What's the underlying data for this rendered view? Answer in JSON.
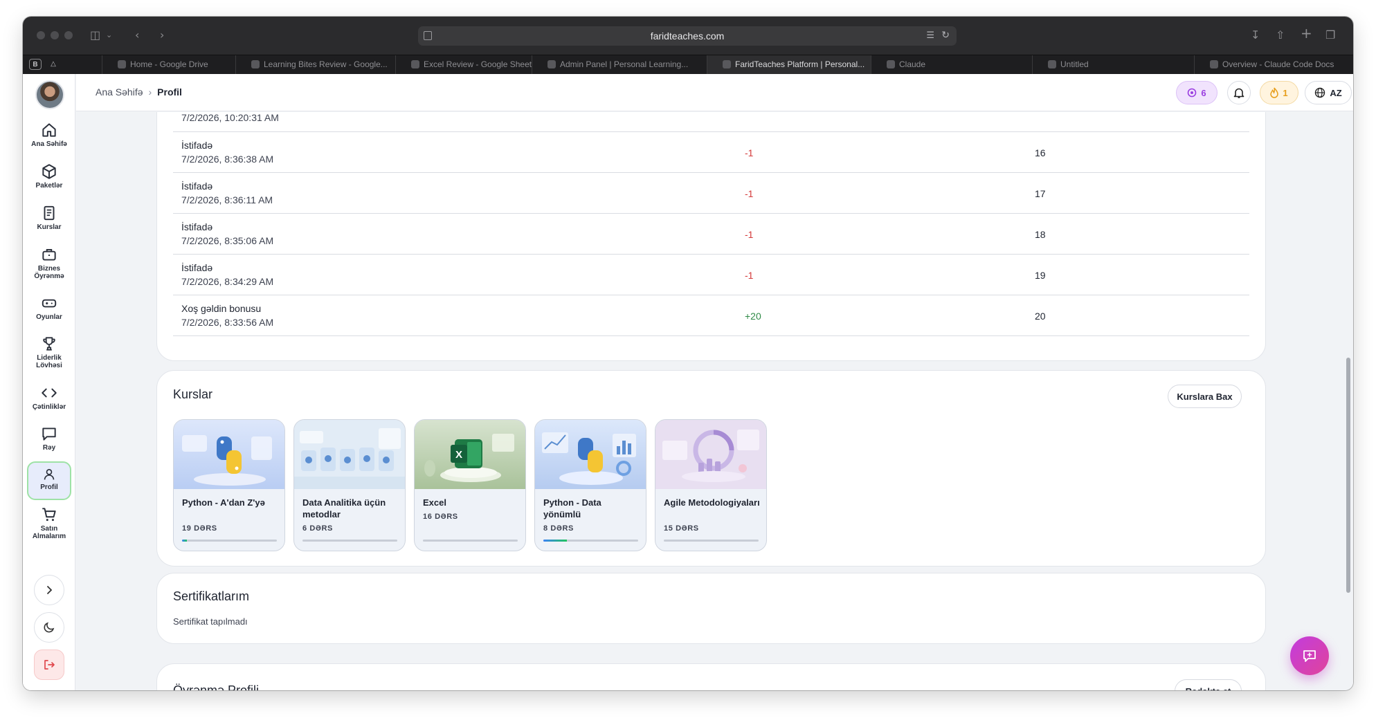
{
  "browser": {
    "url": "faridteaches.com",
    "pinned": [
      "B"
    ],
    "tabs": [
      {
        "label": "Home - Google Drive"
      },
      {
        "label": "Learning Bites Review - Google..."
      },
      {
        "label": "Excel Review - Google Sheets"
      },
      {
        "label": "Admin Panel | Personal Learning..."
      },
      {
        "label": "FaridTeaches Platform | Personal..."
      },
      {
        "label": "Claude"
      },
      {
        "label": "Untitled"
      },
      {
        "label": "Overview - Claude Code Docs"
      }
    ],
    "active_tab": 4
  },
  "sidebar": {
    "items": [
      {
        "label": "Ana Səhifə",
        "icon": "home-icon"
      },
      {
        "label": "Paketlər",
        "icon": "cube-icon"
      },
      {
        "label": "Kurslar",
        "icon": "document-icon"
      },
      {
        "label": "Biznes Öyrənmə",
        "icon": "briefcase-icon"
      },
      {
        "label": "Oyunlar",
        "icon": "gamepad-icon"
      },
      {
        "label": "Liderlik Lövhəsi",
        "icon": "trophy-icon"
      },
      {
        "label": "Çətinliklər",
        "icon": "code-icon"
      },
      {
        "label": "Rəy",
        "icon": "chat-bubble-icon"
      },
      {
        "label": "Profil",
        "icon": "user-icon"
      },
      {
        "label": "Satın Almalarım",
        "icon": "cart-icon"
      }
    ],
    "active": "Profil"
  },
  "header": {
    "breadcrumb": {
      "home": "Ana Səhifə",
      "current": "Profil"
    },
    "credits": "6",
    "streak": "1",
    "language": "AZ"
  },
  "transactions": {
    "partial_top_date": "7/2/2026, 10:20:31 AM",
    "rows": [
      {
        "type": "İstifadə",
        "date": "7/2/2026, 8:36:38 AM",
        "amount": "-1",
        "balance": "16"
      },
      {
        "type": "İstifadə",
        "date": "7/2/2026, 8:36:11 AM",
        "amount": "-1",
        "balance": "17"
      },
      {
        "type": "İstifadə",
        "date": "7/2/2026, 8:35:06 AM",
        "amount": "-1",
        "balance": "18"
      },
      {
        "type": "İstifadə",
        "date": "7/2/2026, 8:34:29 AM",
        "amount": "-1",
        "balance": "19"
      },
      {
        "type": "Xoş gəldin bonusu",
        "date": "7/2/2026, 8:33:56 AM",
        "amount": "+20",
        "balance": "20"
      }
    ]
  },
  "courses": {
    "title": "Kurslar",
    "view_button": "Kurslara Bax",
    "items": [
      {
        "name": "Python - A'dan Z'yə",
        "lessons": "19 DƏRS",
        "progress": 0.05,
        "theme": "python"
      },
      {
        "name": "Data Analitika üçün metodlar",
        "lessons": "6 DƏRS",
        "progress": 0,
        "theme": "analytics"
      },
      {
        "name": "Excel",
        "lessons": "16 DƏRS",
        "progress": 0,
        "theme": "excel"
      },
      {
        "name": "Python - Data yönümlü",
        "lessons": "8 DƏRS",
        "progress": 0.25,
        "theme": "python-data"
      },
      {
        "name": "Agile Metodologiyaları",
        "lessons": "15 DƏRS",
        "progress": 0,
        "theme": "agile"
      }
    ]
  },
  "certificates": {
    "title": "Sertifikatlarım",
    "empty": "Sertifikat tapılmadı"
  },
  "learning_profile": {
    "title": "Öyrənmə Profili",
    "edit_button": "Redaktə et"
  },
  "colors": {
    "accent_purple": "#9a3ee0",
    "negative": "#d43a3a",
    "positive": "#2f8a47",
    "fab": "#d43fc0"
  }
}
